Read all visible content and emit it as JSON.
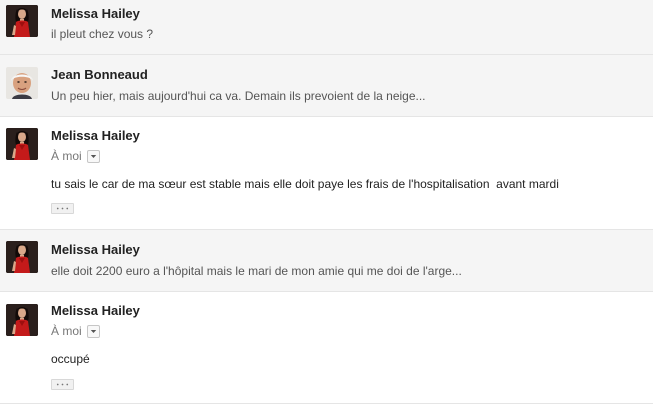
{
  "messages": [
    {
      "sender": "Melissa Hailey",
      "snippet": "il pleut chez vous ?",
      "avatar_icon": "woman-red-dress-avatar"
    },
    {
      "sender": "Jean Bonneaud",
      "snippet": "Un peu hier, mais aujourd'hui ca va. Demain ils prevoient de la neige...",
      "avatar_icon": "older-man-avatar"
    },
    {
      "sender": "Melissa Hailey",
      "recipient": "À moi",
      "body": "tu sais le car de ma sœur est stable mais elle doit paye les frais de l'hospitalisation  avant mardi",
      "avatar_icon": "woman-red-dress-avatar"
    },
    {
      "sender": "Melissa Hailey",
      "snippet": "elle doit 2200 euro a l'hôpital mais le mari de mon amie qui me doi de l'arge...",
      "avatar_icon": "woman-red-dress-avatar"
    },
    {
      "sender": "Melissa Hailey",
      "recipient": "À moi",
      "body": "occupé",
      "avatar_icon": "woman-red-dress-avatar"
    }
  ],
  "colors": {
    "collapsed_bg": "#f5f5f5",
    "expanded_bg": "#ffffff",
    "divider": "#e5e5e5",
    "sender_text": "#222222",
    "snippet_text": "#555555",
    "dress_red": "#c41a1a"
  }
}
